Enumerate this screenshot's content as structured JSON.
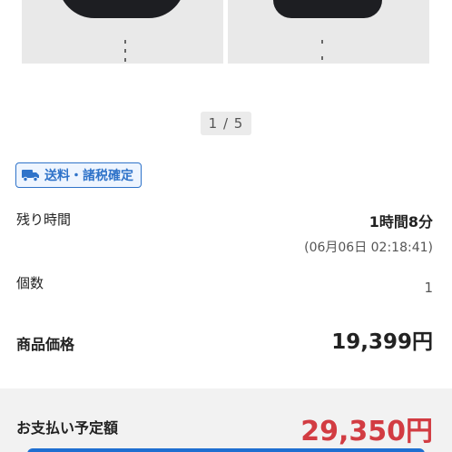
{
  "gallery": {
    "images": [
      {
        "alt": "product-photo-1",
        "icon": "product-photo"
      },
      {
        "alt": "product-photo-2",
        "icon": "product-photo"
      }
    ],
    "pager": "1 / 5"
  },
  "shipping_badge": {
    "icon": "truck-icon",
    "label": "送料・諸税確定",
    "color": "#2f73c9"
  },
  "time_remaining": {
    "label": "残り時間",
    "value": "1時間8分",
    "deadline": "(06月06日 02:18:41)"
  },
  "quantity": {
    "label": "個数",
    "value": "1"
  },
  "item_price": {
    "label": "商品価格",
    "value": "19,399円"
  },
  "payment": {
    "label": "お支払い予定額",
    "value": "29,350円",
    "value_color": "#d23c42",
    "button_color": "#1f6fd1"
  }
}
